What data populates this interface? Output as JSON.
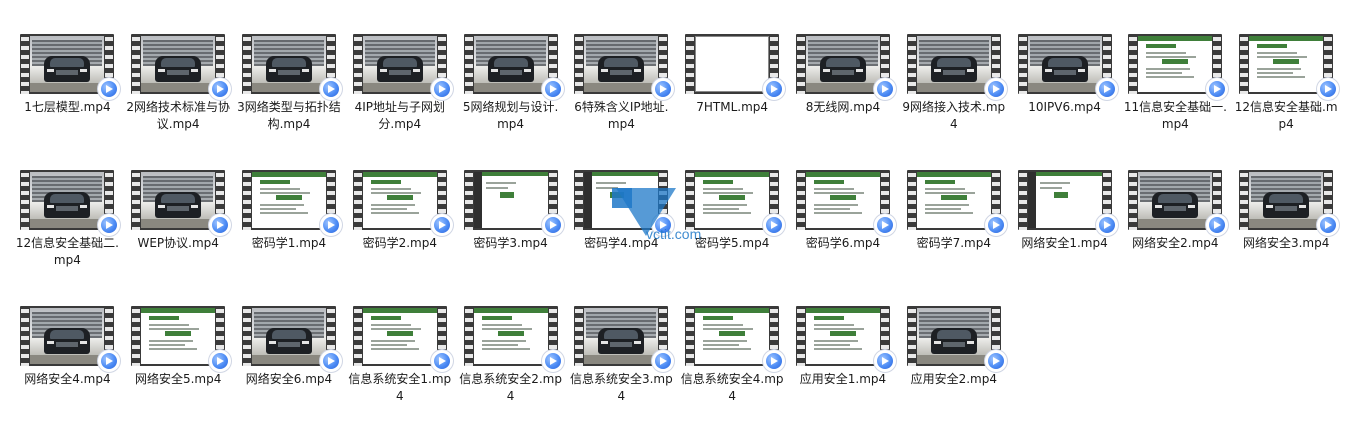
{
  "files": [
    {
      "name": "1七层模型.mp4",
      "thumb": "car"
    },
    {
      "name": "2网络技术标准与协议.mp4",
      "thumb": "car"
    },
    {
      "name": "3网络类型与拓扑结构.mp4",
      "thumb": "car"
    },
    {
      "name": "4IP地址与子网划分.mp4",
      "thumb": "car"
    },
    {
      "name": "5网络规划与设计.mp4",
      "thumb": "car"
    },
    {
      "name": "6特殊含义IP地址.mp4",
      "thumb": "car"
    },
    {
      "name": "7HTML.mp4",
      "thumb": "blank"
    },
    {
      "name": "8无线网.mp4",
      "thumb": "car"
    },
    {
      "name": "9网络接入技术.mp4",
      "thumb": "car"
    },
    {
      "name": "10IPV6.mp4",
      "thumb": "car"
    },
    {
      "name": "11信息安全基础一.mp4",
      "thumb": "slide"
    },
    {
      "name": "12信息安全基础.mp4",
      "thumb": "slide"
    },
    {
      "name": "12信息安全基础二.mp4",
      "thumb": "car"
    },
    {
      "name": "WEP协议.mp4",
      "thumb": "car"
    },
    {
      "name": "密码学1.mp4",
      "thumb": "slide"
    },
    {
      "name": "密码学2.mp4",
      "thumb": "slide"
    },
    {
      "name": "密码学3.mp4",
      "thumb": "dark"
    },
    {
      "name": "密码学4.mp4",
      "thumb": "dark"
    },
    {
      "name": "密码学5.mp4",
      "thumb": "slide"
    },
    {
      "name": "密码学6.mp4",
      "thumb": "slide"
    },
    {
      "name": "密码学7.mp4",
      "thumb": "slide"
    },
    {
      "name": "网络安全1.mp4",
      "thumb": "dark"
    },
    {
      "name": "网络安全2.mp4",
      "thumb": "car"
    },
    {
      "name": "网络安全3.mp4",
      "thumb": "car"
    },
    {
      "name": "网络安全4.mp4",
      "thumb": "car"
    },
    {
      "name": "网络安全5.mp4",
      "thumb": "slide"
    },
    {
      "name": "网络安全6.mp4",
      "thumb": "car"
    },
    {
      "name": "信息系统安全1.mp4",
      "thumb": "slide"
    },
    {
      "name": "信息系统安全2.mp4",
      "thumb": "slide"
    },
    {
      "name": "信息系统安全3.mp4",
      "thumb": "car"
    },
    {
      "name": "信息系统安全4.mp4",
      "thumb": "slide"
    },
    {
      "name": "应用安全1.mp4",
      "thumb": "slide"
    },
    {
      "name": "应用安全2.mp4",
      "thumb": "car"
    }
  ],
  "watermark": "vctit.com",
  "accent_color": "#4d8cf5",
  "badge_icon": "video-play-icon"
}
